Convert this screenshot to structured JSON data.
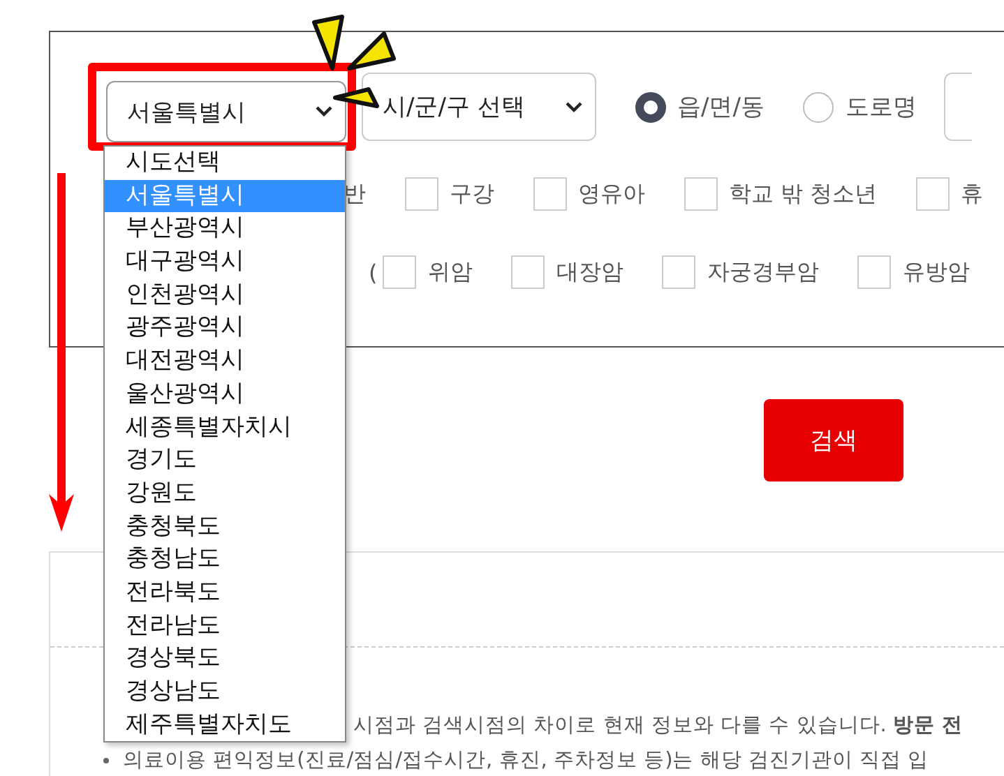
{
  "region_select": {
    "value": "서울특별시",
    "options": [
      {
        "label": "시도선택",
        "selected": false
      },
      {
        "label": "서울특별시",
        "selected": true
      },
      {
        "label": "부산광역시",
        "selected": false
      },
      {
        "label": "대구광역시",
        "selected": false
      },
      {
        "label": "인천광역시",
        "selected": false
      },
      {
        "label": "광주광역시",
        "selected": false
      },
      {
        "label": "대전광역시",
        "selected": false
      },
      {
        "label": "울산광역시",
        "selected": false
      },
      {
        "label": "세종특별자치시",
        "selected": false
      },
      {
        "label": "경기도",
        "selected": false
      },
      {
        "label": "강원도",
        "selected": false
      },
      {
        "label": "충청북도",
        "selected": false
      },
      {
        "label": "충청남도",
        "selected": false
      },
      {
        "label": "전라북도",
        "selected": false
      },
      {
        "label": "전라남도",
        "selected": false
      },
      {
        "label": "경상북도",
        "selected": false
      },
      {
        "label": "경상남도",
        "selected": false
      },
      {
        "label": "제주특별자치도",
        "selected": false
      }
    ]
  },
  "district_select": {
    "value": "시/군/구 선택"
  },
  "address_type": [
    {
      "label": "읍/면/동",
      "selected": true
    },
    {
      "label": "도로명",
      "selected": false
    }
  ],
  "target_label_fragment": "반",
  "target_options": [
    {
      "label": "구강",
      "checked": false
    },
    {
      "label": "영유아",
      "checked": false
    },
    {
      "label": "학교 밖 청소년",
      "checked": false
    },
    {
      "label": "휴",
      "checked": false
    }
  ],
  "cancer_prefix": "(",
  "cancer_options": [
    {
      "label": "위암",
      "checked": false
    },
    {
      "label": "대장암",
      "checked": false
    },
    {
      "label": "자궁경부암",
      "checked": false
    },
    {
      "label": "유방암",
      "checked": false
    }
  ],
  "search_button": "검색",
  "notices": [
    {
      "text": "시점과 검색시점의 차이로 현재 정보와 다를 수 있습니다. **방문 전**"
    },
    {
      "text": "의료이용 편익정보(진료/점심/접수시간, 휴진, 주차정보 등)는 해당 검진기관이 직접 입"
    }
  ]
}
